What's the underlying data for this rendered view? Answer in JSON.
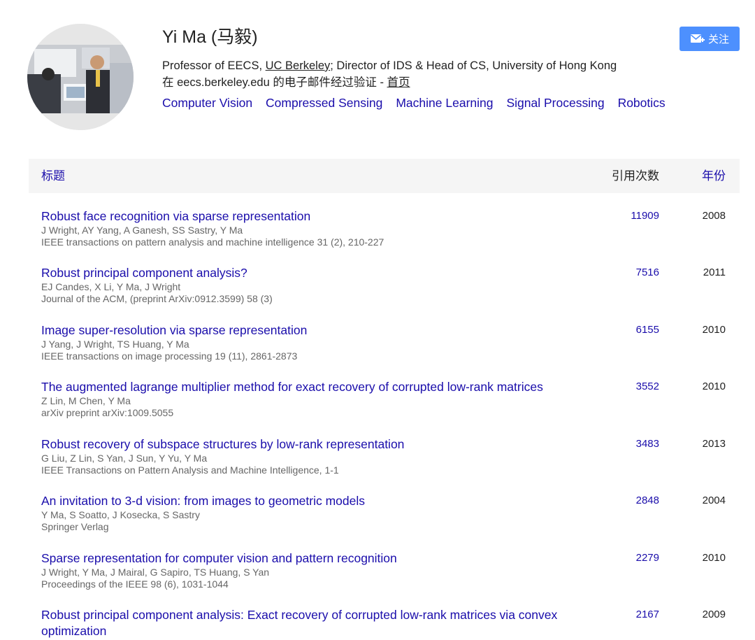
{
  "profile": {
    "name": "Yi Ma (马毅)",
    "affiliation_prefix": "Professor of EECS, ",
    "affiliation_link": "UC Berkeley",
    "affiliation_suffix": "; Director of IDS & Head of CS, University of Hong Kong",
    "email_text": "在 eecs.berkeley.edu 的电子邮件经过验证 - ",
    "homepage_label": "首页",
    "interests": [
      "Computer Vision",
      "Compressed Sensing",
      "Machine Learning",
      "Signal Processing",
      "Robotics"
    ]
  },
  "follow_button": {
    "label": "关注",
    "icon": "mail-plus-icon"
  },
  "table": {
    "headers": {
      "title": "标题",
      "cited_by": "引用次数",
      "year": "年份"
    },
    "rows": [
      {
        "title": "Robust face recognition via sparse representation",
        "authors": "J Wright, AY Yang, A Ganesh, SS Sastry, Y Ma",
        "venue": "IEEE transactions on pattern analysis and machine intelligence 31 (2), 210-227",
        "cites": "11909",
        "year": "2008"
      },
      {
        "title": "Robust principal component analysis?",
        "authors": "EJ Candes, X Li, Y Ma, J Wright",
        "venue": "Journal of the ACM, (preprint ArXiv:0912.3599) 58 (3)",
        "cites": "7516",
        "year": "2011"
      },
      {
        "title": "Image super-resolution via sparse representation",
        "authors": "J Yang, J Wright, TS Huang, Y Ma",
        "venue": "IEEE transactions on image processing 19 (11), 2861-2873",
        "cites": "6155",
        "year": "2010"
      },
      {
        "title": "The augmented lagrange multiplier method for exact recovery of corrupted low-rank matrices",
        "authors": "Z Lin, M Chen, Y Ma",
        "venue": "arXiv preprint arXiv:1009.5055",
        "cites": "3552",
        "year": "2010"
      },
      {
        "title": "Robust recovery of subspace structures by low-rank representation",
        "authors": "G Liu, Z Lin, S Yan, J Sun, Y Yu, Y Ma",
        "venue": "IEEE Transactions on Pattern Analysis and Machine Intelligence, 1-1",
        "cites": "3483",
        "year": "2013"
      },
      {
        "title": "An invitation to 3-d vision: from images to geometric models",
        "authors": "Y Ma, S Soatto, J Kosecka, S Sastry",
        "venue": "Springer Verlag",
        "cites": "2848",
        "year": "2004"
      },
      {
        "title": "Sparse representation for computer vision and pattern recognition",
        "authors": "J Wright, Y Ma, J Mairal, G Sapiro, TS Huang, S Yan",
        "venue": "Proceedings of the IEEE 98 (6), 1031-1044",
        "cites": "2279",
        "year": "2010"
      },
      {
        "title": "Robust principal component analysis: Exact recovery of corrupted low-rank matrices via convex optimization",
        "authors": "",
        "venue": "",
        "cites": "2167",
        "year": "2009"
      }
    ]
  }
}
